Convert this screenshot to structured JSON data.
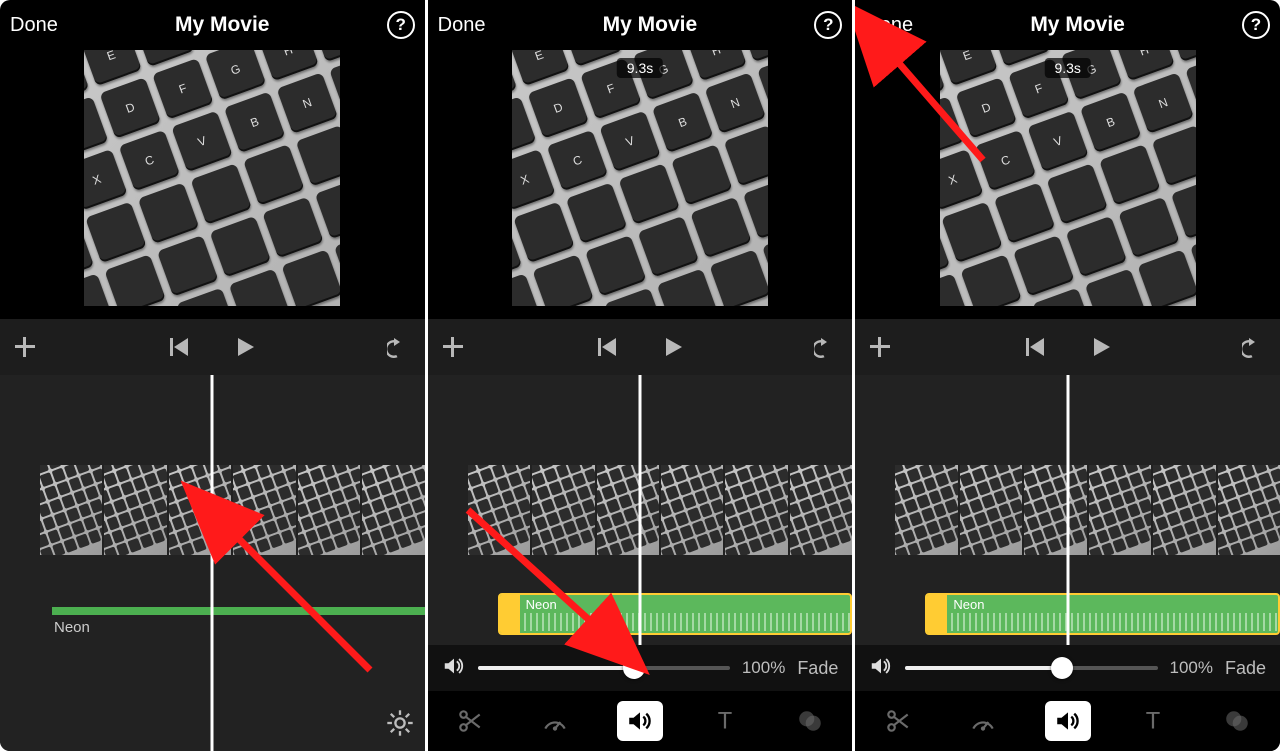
{
  "common": {
    "done_label": "Done",
    "title": "My Movie",
    "help_glyph": "?",
    "duration_badge": "9.3s",
    "audio_track_name": "Neon",
    "volume_percent": "100%",
    "fade_label": "Fade",
    "slider_fill_pct": 62
  },
  "panels": [
    {
      "show_duration_badge": false,
      "audio_style": "thin",
      "show_volume_row": false,
      "show_tools": false,
      "show_gear": true,
      "arrow": "to-audio"
    },
    {
      "show_duration_badge": true,
      "audio_style": "thick",
      "show_volume_row": true,
      "show_tools": true,
      "show_gear": false,
      "arrow": "to-slider"
    },
    {
      "show_duration_badge": true,
      "audio_style": "thick",
      "show_volume_row": true,
      "show_tools": true,
      "show_gear": false,
      "arrow": "to-done"
    }
  ],
  "icons": {
    "plus": "plus-icon",
    "skip": "skip-back-icon",
    "play": "play-icon",
    "undo": "undo-icon",
    "speaker": "speaker-icon",
    "scissors": "scissors-icon",
    "gauge": "speed-icon",
    "volume": "volume-icon",
    "text": "text-icon",
    "filters": "filters-icon",
    "gear": "gear-icon",
    "help": "help-icon"
  }
}
